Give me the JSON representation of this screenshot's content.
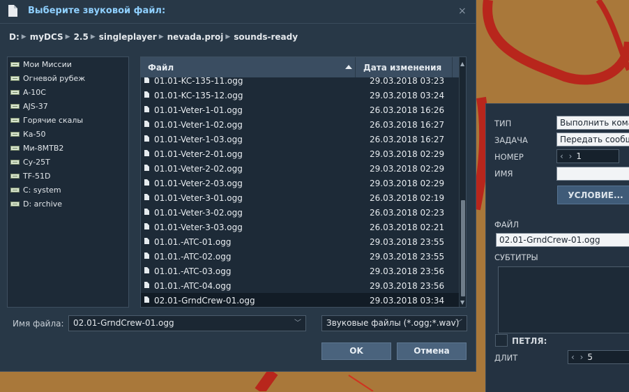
{
  "dialog": {
    "title": "Выберите звуковой файл:",
    "close_glyph": "×",
    "breadcrumb": [
      "D:",
      "myDCS",
      "2.5",
      "singleplayer",
      "nevada.proj",
      "sounds-ready"
    ],
    "breadcrumb_sep": "▶",
    "places": [
      "Мои Миссии",
      "Огневой рубеж",
      "A-10C",
      "AJS-37",
      "Горячие скалы",
      "Ка-50",
      "Ми-8МТВ2",
      "Су-25Т",
      "TF-51D",
      "C: system",
      "D: archive"
    ],
    "columns": {
      "name": "Файл",
      "date": "Дата изменения"
    },
    "files": [
      {
        "name": "01.01-KC-135-11.ogg",
        "date": "29.03.2018 03:23"
      },
      {
        "name": "01.01-KC-135-12.ogg",
        "date": "29.03.2018 03:24"
      },
      {
        "name": "01.01-Veter-1-01.ogg",
        "date": "26.03.2018 16:26"
      },
      {
        "name": "01.01-Veter-1-02.ogg",
        "date": "26.03.2018 16:27"
      },
      {
        "name": "01.01-Veter-1-03.ogg",
        "date": "26.03.2018 16:27"
      },
      {
        "name": "01.01-Veter-2-01.ogg",
        "date": "29.03.2018 02:29"
      },
      {
        "name": "01.01-Veter-2-02.ogg",
        "date": "29.03.2018 02:29"
      },
      {
        "name": "01.01-Veter-2-03.ogg",
        "date": "29.03.2018 02:29"
      },
      {
        "name": "01.01-Veter-3-01.ogg",
        "date": "26.03.2018 02:19"
      },
      {
        "name": "01.01-Veter-3-02.ogg",
        "date": "26.03.2018 02:23"
      },
      {
        "name": "01.01-Veter-3-03.ogg",
        "date": "26.03.2018 02:21"
      },
      {
        "name": "01.01.-ATC-01.ogg",
        "date": "29.03.2018 23:55"
      },
      {
        "name": "01.01.-ATC-02.ogg",
        "date": "29.03.2018 23:55"
      },
      {
        "name": "01.01.-ATC-03.ogg",
        "date": "29.03.2018 23:56"
      },
      {
        "name": "01.01.-ATC-04.ogg",
        "date": "29.03.2018 23:56"
      },
      {
        "name": "02.01-GrndCrew-01.ogg",
        "date": "29.03.2018 03:34",
        "selected": true
      }
    ],
    "filename_label": "Имя файла:",
    "filename_value": "02.01-GrndCrew-01.ogg",
    "filter_value": "Звуковые файлы (*.ogg;*.wav)",
    "ok_label": "OK",
    "cancel_label": "Отмена"
  },
  "trigger_panel": {
    "type_label": "ТИП",
    "type_value": "Выполнить кома",
    "task_label": "ЗАДАЧА",
    "task_value": "Передать сообщ",
    "number_label": "НОМЕР",
    "number_value": "1",
    "name_label": "ИМЯ",
    "name_value": "",
    "condition_button": "УСЛОВИЕ...",
    "file_label": "ФАЙЛ",
    "file_value": "02.01-GrndCrew-01.ogg",
    "subtitles_label": "СУБТИТРЫ",
    "loop_label": "ПЕТЛЯ:",
    "duration_label": "ДЛИТ",
    "duration_value": "5"
  },
  "colors": {
    "accent_title": "#8fd0ff",
    "dialog_bg": "#283847",
    "map_bg": "#a9783a",
    "road": "#b3261e"
  }
}
